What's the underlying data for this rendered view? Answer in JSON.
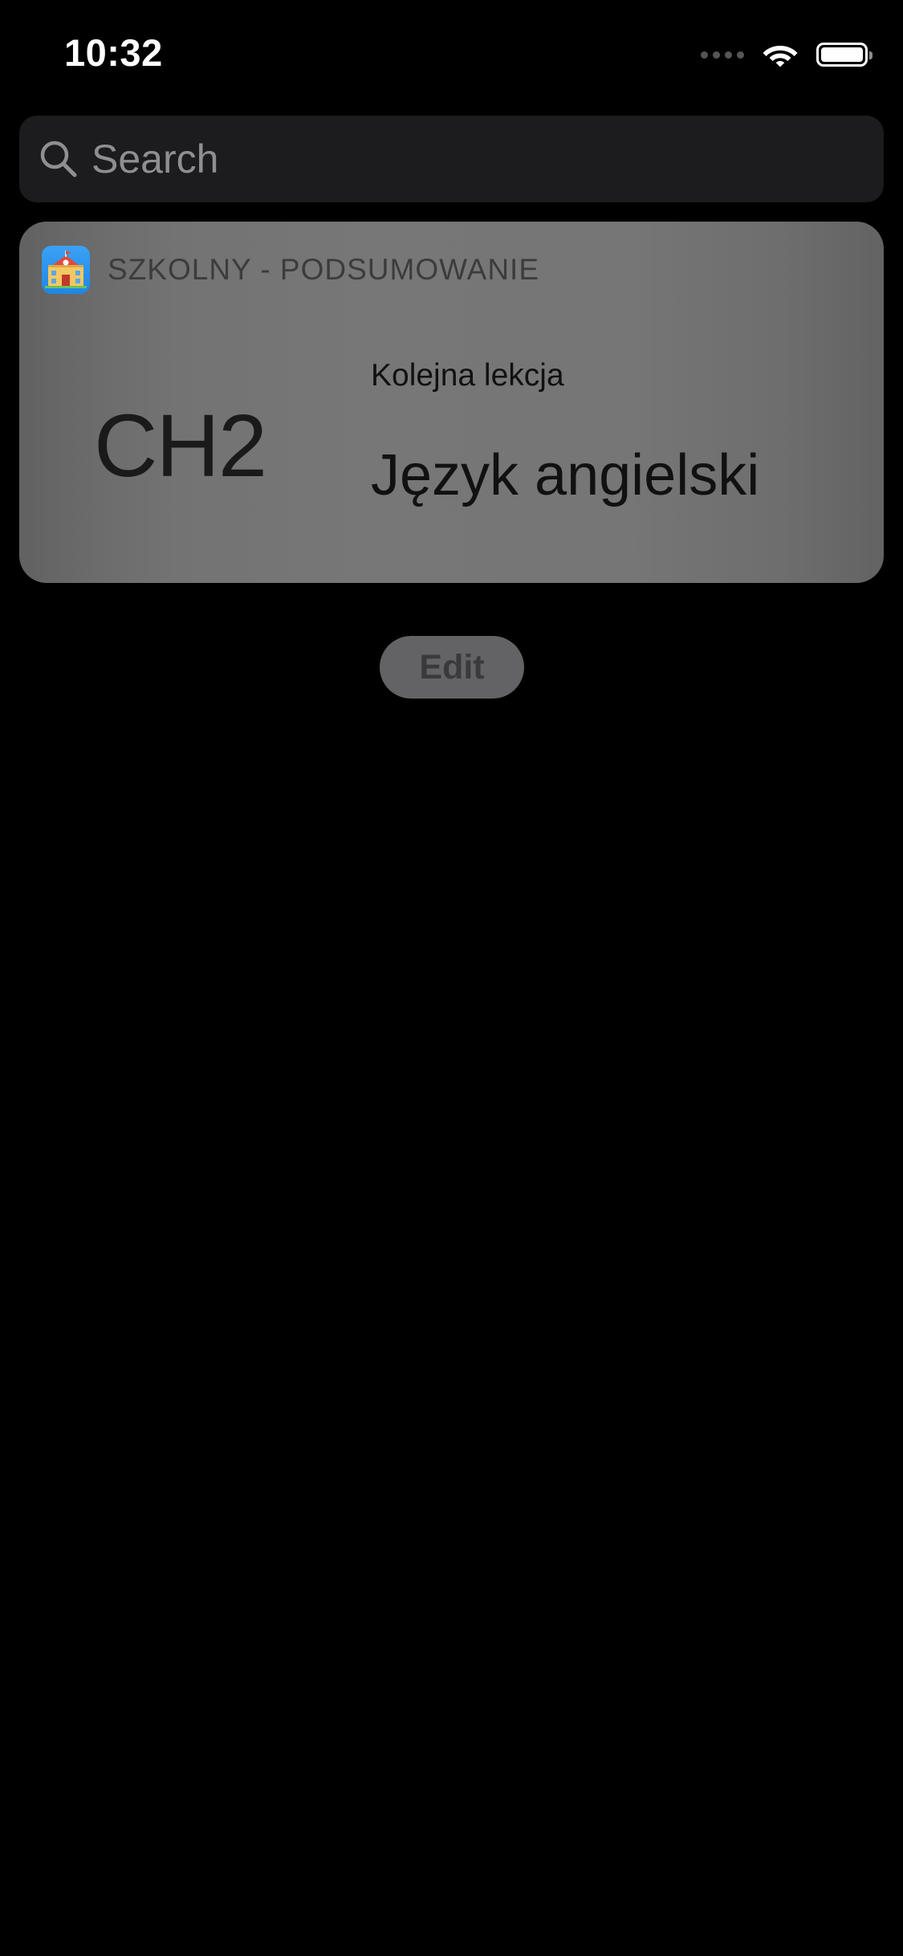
{
  "status_bar": {
    "time": "10:32"
  },
  "search": {
    "placeholder": "Search"
  },
  "widget": {
    "app_name": "SZKOLNY - PODSUMOWANIE",
    "room_code": "CH2",
    "next_label": "Kolejna lekcja",
    "lesson_name": "Język angielski",
    "app_icon": "school-icon"
  },
  "edit_button": {
    "label": "Edit"
  },
  "colors": {
    "background": "#000000",
    "search_bg": "#1c1c1e",
    "widget_bg": "#757575",
    "app_icon_blue": "#2a93ec"
  }
}
